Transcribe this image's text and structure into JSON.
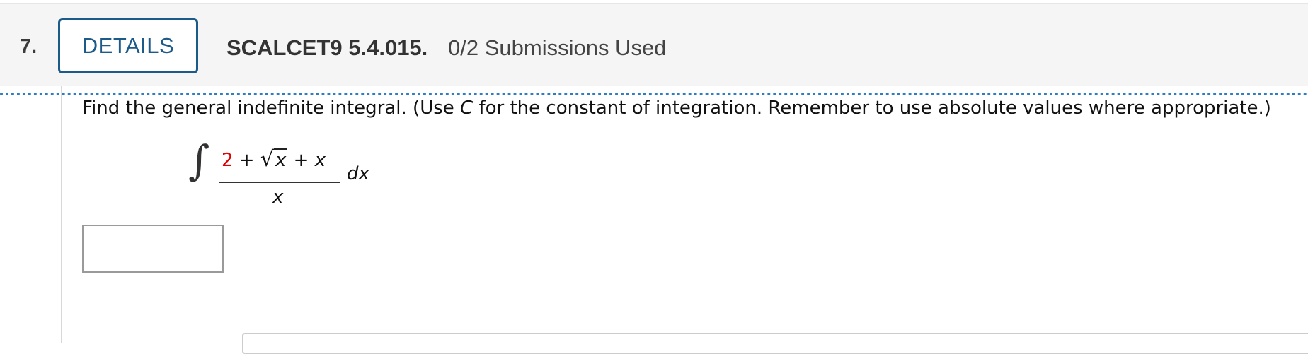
{
  "question": {
    "number": "7.",
    "details_label": "DETAILS",
    "code": "SCALCET9 5.4.015.",
    "submissions": "0/2 Submissions Used"
  },
  "problem": {
    "instruction_part1": "Find the general indefinite integral. (Use ",
    "instruction_var": "C",
    "instruction_part2": " for the constant of integration. Remember to use absolute values where appropriate.)",
    "integral_symbol": "∫",
    "numerator_constant": "2",
    "numerator_plus1": " + ",
    "radical_symbol": "√",
    "radicand": "x",
    "numerator_plus2": " + ",
    "numerator_var": "x",
    "denominator": "x",
    "differential": "dx"
  },
  "answer": {
    "value": ""
  },
  "colors": {
    "accent_blue": "#1c5a8a",
    "separator_blue": "#2d7cc4",
    "highlight_red": "#e00000"
  }
}
